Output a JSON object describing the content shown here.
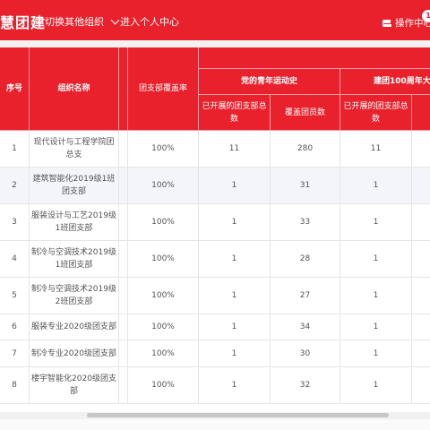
{
  "header": {
    "brand_fragment": "慧团建",
    "switch_org_label": "切换其他组织",
    "personal_center_label": "进入个人中心",
    "ops_center_label": "操作中心",
    "notification_count": "1"
  },
  "table": {
    "headers": {
      "index": "序号",
      "org_name": "组织名称",
      "coverage_rate": "团支部覆盖率",
      "group_a": "党的青年运动史",
      "group_b": "建团100周年大会",
      "sub_branches_total": "已开展的团支部总数",
      "members_covered": "覆盖团员数",
      "sub_branches_total_b": "已开展的团支部总数"
    },
    "rows": [
      {
        "index": "1",
        "name": "现代设计与工程学院团总支",
        "coverage": "100%",
        "a_branches": "11",
        "a_members": "280",
        "b_branches": "11"
      },
      {
        "index": "2",
        "name": "建筑智能化2019级1班团支部",
        "coverage": "100%",
        "a_branches": "1",
        "a_members": "31",
        "b_branches": "1"
      },
      {
        "index": "3",
        "name": "服装设计与工艺2019级1班团支部",
        "coverage": "100%",
        "a_branches": "1",
        "a_members": "33",
        "b_branches": "1"
      },
      {
        "index": "4",
        "name": "制冷与空调技术2019级1班团支部",
        "coverage": "100%",
        "a_branches": "1",
        "a_members": "28",
        "b_branches": "1"
      },
      {
        "index": "5",
        "name": "制冷与空调技术2019级2班团支部",
        "coverage": "100%",
        "a_branches": "1",
        "a_members": "27",
        "b_branches": "1"
      },
      {
        "index": "6",
        "name": "服装专业2020级团支部",
        "coverage": "100%",
        "a_branches": "1",
        "a_members": "34",
        "b_branches": "1"
      },
      {
        "index": "7",
        "name": "制冷专业2020级团支部",
        "coverage": "100%",
        "a_branches": "1",
        "a_members": "30",
        "b_branches": "1"
      },
      {
        "index": "8",
        "name": "楼宇智能化2020级团支部",
        "coverage": "100%",
        "a_branches": "1",
        "a_members": "32",
        "b_branches": "1"
      }
    ]
  },
  "colors": {
    "brand_red": "#e8212c",
    "alt_row": "#f4f5fb"
  }
}
